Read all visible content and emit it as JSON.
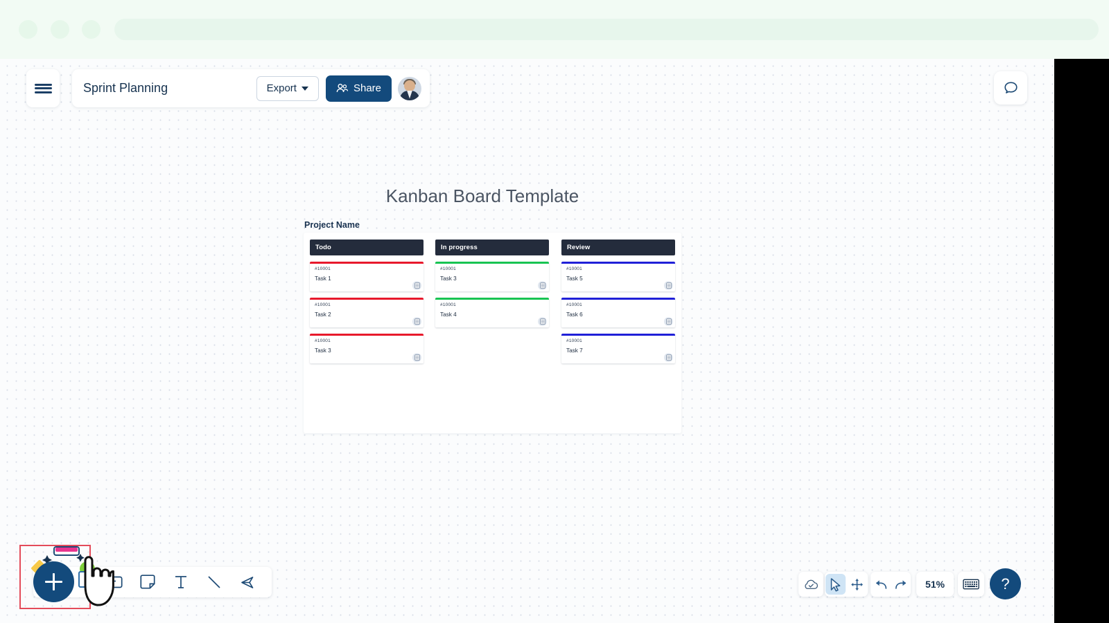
{
  "browser": {
    "dots": [
      "dot-1",
      "dot-2",
      "dot-3"
    ],
    "urlbar_value": ""
  },
  "topbar": {
    "menu_icon": "hamburger-icon",
    "doc_title": "Sprint Planning",
    "export_label": "Export",
    "export_caret_icon": "chevron-down-icon",
    "share_label": "Share",
    "share_icon": "people-icon",
    "avatar_alt": "user-avatar",
    "comment_icon": "chat-bubble-icon"
  },
  "board": {
    "title": "Kanban Board Template",
    "project_label": "Project Name",
    "columns": [
      {
        "name": "Todo",
        "accent": "#e8192c",
        "cards": [
          {
            "ticket": "#10001",
            "name": "Task 1",
            "icon": "database-icon"
          },
          {
            "ticket": "#10001",
            "name": "Task 2",
            "icon": "database-icon"
          },
          {
            "ticket": "#10001",
            "name": "Task 3",
            "icon": "database-icon"
          }
        ]
      },
      {
        "name": "In progress",
        "accent": "#18c452",
        "cards": [
          {
            "ticket": "#10001",
            "name": "Task 3",
            "icon": "database-icon"
          },
          {
            "ticket": "#10001",
            "name": "Task 4",
            "icon": "database-icon"
          }
        ]
      },
      {
        "name": "Review",
        "accent": "#2020d8",
        "cards": [
          {
            "ticket": "#10001",
            "name": "Task 5",
            "icon": "database-icon"
          },
          {
            "ticket": "#10001",
            "name": "Task 6",
            "icon": "database-icon"
          },
          {
            "ticket": "#10001",
            "name": "Task 7",
            "icon": "database-icon"
          }
        ]
      }
    ]
  },
  "toolbar": {
    "add_label": "+",
    "add_icon": "plus-icon",
    "tools": [
      {
        "icon": "card-icon",
        "label": "Card"
      },
      {
        "icon": "sticky-note-icon",
        "label": "Sticky note"
      },
      {
        "icon": "text-icon",
        "label": "Text"
      },
      {
        "icon": "line-icon",
        "label": "Line"
      },
      {
        "icon": "pen-icon",
        "label": "Pen"
      }
    ]
  },
  "statusbar": {
    "cloud_icon": "cloud-check-icon",
    "select_icon": "cursor-arrow-icon",
    "move_icon": "move-icon",
    "undo_icon": "undo-icon",
    "redo_icon": "redo-icon",
    "zoom_level": "51%",
    "keyboard_icon": "keyboard-icon",
    "help_label": "?"
  },
  "colors": {
    "brand_blue": "#134a7c",
    "header_navy": "#242c3c",
    "selection_red": "#e34b5a",
    "chrome_green": "#f2fbf4"
  }
}
